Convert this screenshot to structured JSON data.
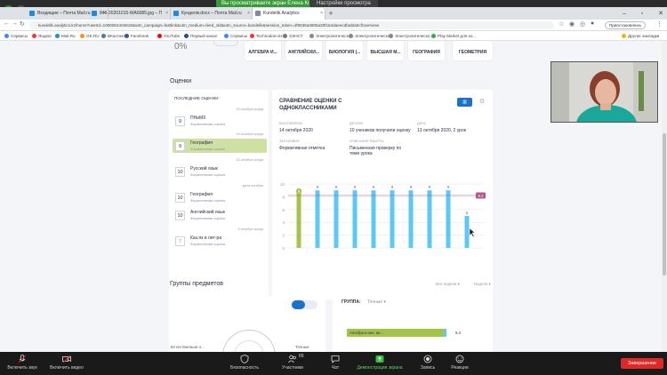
{
  "share_banner": {
    "text": "Вы просматриваете экран Елена Королёва",
    "view_settings": "Настройки просмотра"
  },
  "browser": {
    "tabs": [
      {
        "label": "Входящие – Почта Mail.ru",
        "color": "#168de2"
      },
      {
        "label": "840-20201015-WA0085.jpg – П",
        "color": "#168de2"
      },
      {
        "label": "Кунделік.docx – Почта Mail.ru",
        "color": "#168de2"
      },
      {
        "label": "Kundelik.Analytics",
        "color": "#7b8a9c",
        "active": true
      }
    ],
    "url": "kundelik.analytics.kz/home?userId=1000004404618&utm_campaign=fastlink&utm_medium=feed_old&utm_source=kundelik&session_token=4f9036a3585a30f154daeecdfadda0cf/overview",
    "pause_label": "Приостановлена",
    "bookmarks": [
      {
        "label": "Сервисы",
        "color": "#4285f4"
      },
      {
        "label": "Яндекс",
        "color": "#ff3333"
      },
      {
        "label": "Mail.Ru",
        "color": "#168de2"
      },
      {
        "label": "OK.RU",
        "color": "#f7931e"
      },
      {
        "label": "ВКонтакте",
        "color": "#4a76a8"
      },
      {
        "label": "Facebook",
        "color": "#3b5998"
      },
      {
        "label": "YouTube",
        "color": "#ff0000"
      },
      {
        "label": "Первый канал",
        "color": "#1e4a9c"
      },
      {
        "label": "Сервисы",
        "color": "#4285f4"
      },
      {
        "label": "Technodom.kz",
        "color": "#e53935"
      },
      {
        "label": "ХЭНСТ",
        "color": "#777777"
      },
      {
        "label": "Электролитическо...",
        "color": "#888888"
      },
      {
        "label": "Электролитическо...",
        "color": "#888888"
      },
      {
        "label": "Электролитическо...",
        "color": "#888888"
      },
      {
        "label": "Play Market для ко...",
        "color": "#34a853"
      },
      {
        "label": "Другие закладки",
        "color": "#f4b400"
      }
    ]
  },
  "page": {
    "percent": "0%",
    "subjects": [
      "АЛГЕБРА И...",
      "АНГЛИЙСКИ...",
      "БИОЛОГИЯ (...",
      "ВЫСШАЯ М...",
      "ГЕОГРАФИЯ",
      "ГЕОМЕТРИЯ"
    ],
    "grades_title": "Оценки",
    "recent_title": "ПОСЛЕДНИЕ ОЦЕНКИ",
    "grades": [
      {
        "date": "15 октября среда",
        "value": "9",
        "subject": "ПНиМХ",
        "type": "Формативная оценка"
      },
      {
        "date": "14 октября среда",
        "value": "9",
        "subject": "География",
        "type": "Формативная оценка",
        "selected": true
      },
      {
        "date": "13 октября среда",
        "value": "10",
        "subject": "Русский язык",
        "type": "Формативная оценка"
      },
      {
        "date": "дата октября",
        "value": "10",
        "subject": "География",
        "type": "Формативная оценка"
      },
      {
        "date": "",
        "value": "10",
        "subject": "Английский язык",
        "type": "Формативная оценка"
      },
      {
        "date": "5 октября среда",
        "value": "7",
        "subject": "Каз.яз и лит-ра",
        "type": "Формативная оценка"
      }
    ],
    "comparison": {
      "title": "СРАВНЕНИЕ ОЦЕНКИ С ОДНОКЛАССНИКАМИ",
      "meta": [
        {
          "label": "ВЫСТАВЛЕНА",
          "value": "14 октября 2020"
        },
        {
          "label": "ДЕТАЛИ",
          "value": "10 учеников получили оценку"
        },
        {
          "label": "ДАТА",
          "value": "13 октября 2020, 2 урок"
        },
        {
          "label": "ЗАГОЛОВОК",
          "value": "Формативная отметка"
        },
        {
          "label": "ОПИСАНИЕ РАБОТЫ",
          "value": "Письменная проверку по теме урока"
        }
      ]
    },
    "groups_title": "Группы предметов",
    "groups": {
      "filter1": "Все недели",
      "filter2": "Неделя",
      "group_label": "ГРУППА:",
      "group_value": "Точные",
      "bar_name": "Алгебра и нач. ан...",
      "bar_value": "9.2",
      "bar_fraction": 0.92,
      "radar_left": "Естественные н...",
      "radar_right": "Точные"
    }
  },
  "chart_data": {
    "type": "bar",
    "categories": [
      "1",
      "2",
      "3",
      "4",
      "5",
      "6",
      "7",
      "8",
      "9",
      "10"
    ],
    "values": [
      9,
      9,
      9,
      9,
      9,
      9,
      9,
      9,
      9,
      5
    ],
    "data_labels": [
      "9",
      "9",
      "9",
      "9",
      "9",
      "9",
      "9",
      "9",
      "9",
      "5"
    ],
    "highlight_index": 0,
    "average": 8.2,
    "average_label": "8.2",
    "yticks": [
      0,
      2,
      4,
      6,
      8,
      10
    ],
    "ylim": [
      0,
      10
    ],
    "colors": {
      "bar": "#5bc8f5",
      "highlight": "#a6c349",
      "average": "#b5548a"
    }
  },
  "zoom": {
    "buttons": [
      {
        "label": "Включить звук",
        "icon": "microphone-muted-icon"
      },
      {
        "label": "Включить видео",
        "icon": "video-off-icon"
      },
      {
        "label": "Безопасность",
        "icon": "shield-icon"
      },
      {
        "label": "Участники",
        "icon": "participants-icon",
        "count": "65"
      },
      {
        "label": "Чат",
        "icon": "chat-icon"
      },
      {
        "label": "Демонстрация экрана",
        "icon": "share-screen-icon"
      },
      {
        "label": "Запись",
        "icon": "record-icon"
      },
      {
        "label": "Реакции",
        "icon": "reactions-icon"
      }
    ],
    "end_label": "Завершение"
  }
}
